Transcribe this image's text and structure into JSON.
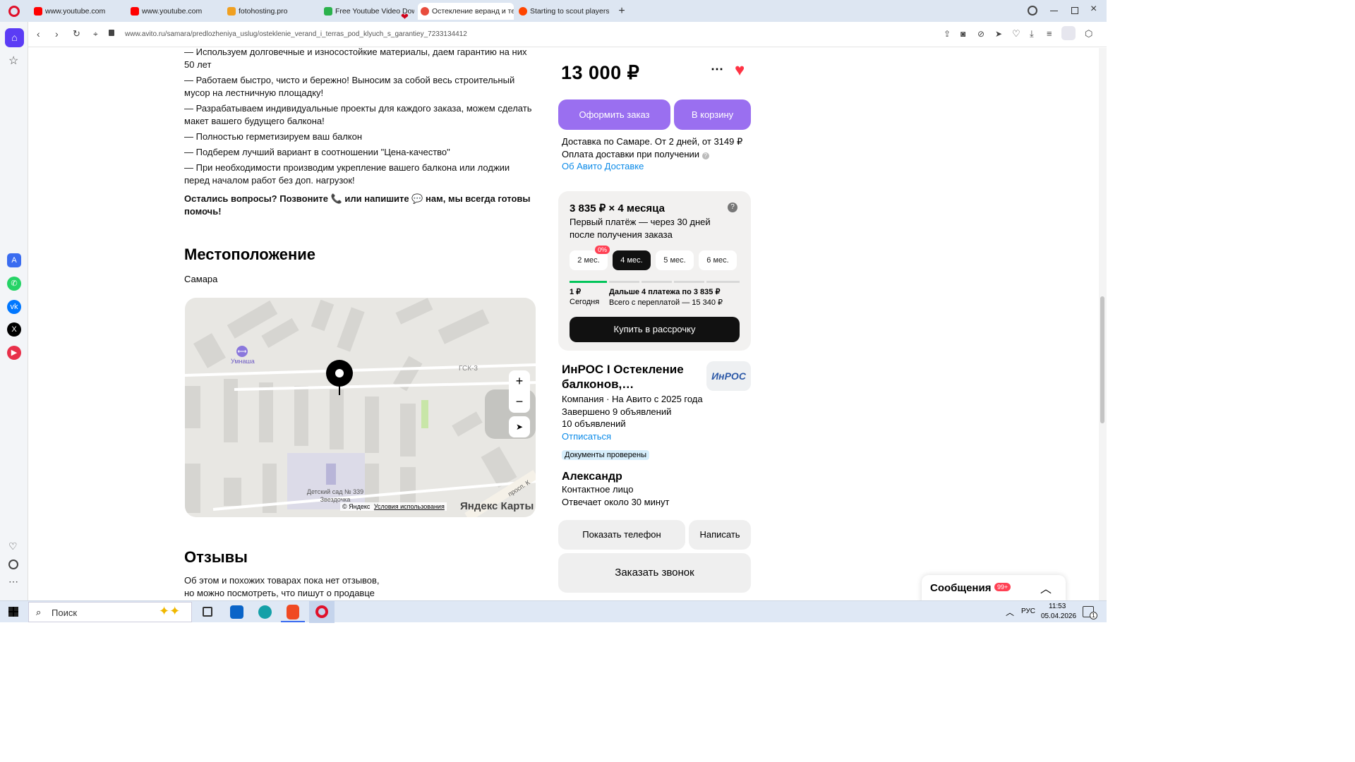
{
  "tabs": [
    {
      "label": "www.youtube.com",
      "color": "#ff0000"
    },
    {
      "label": "www.youtube.com",
      "color": "#ff0000"
    },
    {
      "label": "fotohosting.pro",
      "color": "#f0a020"
    },
    {
      "label": "Free Youtube Video Downl",
      "color": "#2bb24c"
    },
    {
      "label": "Остекление веранд и тер",
      "color": "#e84c3d"
    },
    {
      "label": "Starting to scout players fo",
      "color": "#ff4500"
    }
  ],
  "address": {
    "url": "www.avito.ru/samara/predlozheniya_uslug/osteklenie_verand_i_terras_pod_klyuch_s_garantiey_7233134412"
  },
  "description": {
    "lines": [
      "— Используем долговечные и износостойкие материалы, даем гарантию на них 50 лет",
      "— Работаем быстро, чисто и бережно! Выносим за собой весь строительный мусор на лестничную площадку!",
      "— Разрабатываем индивидуальные проекты для каждого заказа, можем сделать макет вашего будущего балкона!",
      "— Полностью герметизируем ваш балкон",
      "— Подберем лучший вариант в соотношении \"Цена-качество\"",
      "— При необходимости производим укрепление вашего балкона или лоджии перед началом работ без доп. нагрузок!"
    ],
    "cta": "Остались вопросы? Позвоните 📞 или напишите 💬 нам, мы всегда готовы помочь!"
  },
  "location": {
    "title": "Местоположение",
    "city": "Самара"
  },
  "map": {
    "place": "Умнаша",
    "kindergarten": "Детский сад № 339 Звездочка",
    "garage": "ГСК-3",
    "copyright": "© Яндекс",
    "terms": "Условия использования",
    "brand": "Яндекс Карты",
    "street": "просп. К"
  },
  "reviews": {
    "title": "Отзывы",
    "text": "Об этом и похожих товарах пока нет отзывов, но можно посмотреть, что пишут о продавце"
  },
  "offer": {
    "price": "13 000 ₽",
    "order_label": "Оформить заказ",
    "cart_label": "В корзину",
    "delivery": "Доставка по Самаре. От 2 дней, от 3149 ₽",
    "payment": "Оплата доставки при получении",
    "delivery_link": "Об Авито Доставке"
  },
  "installment": {
    "title": "3 835 ₽ × 4 месяца",
    "subtitle": "Первый платёж — через 30 дней после получения заказа",
    "options": [
      "2 мес.",
      "4 мес.",
      "5 мес.",
      "6 мес."
    ],
    "badge": "0%",
    "today_amount": "1 ₽",
    "today_label": "Сегодня",
    "next_payments": "Дальше 4 платежа по 3 835 ₽",
    "total": "Всего с переплатой — 15 340 ₽",
    "buy_label": "Купить в рассрочку",
    "progress": 0.25
  },
  "seller": {
    "name": "ИнРОС I Остекление балконов,…",
    "logo_text": "ИнРОС",
    "type": "Компания · На Авито с 2025 года",
    "completed": "Завершено 9 объявлений",
    "ads": "10 объявлений",
    "unsubscribe": "Отписаться",
    "verified": "Документы проверены",
    "contact_name": "Александр",
    "contact_role": "Контактное лицо",
    "response": "Отвечает около 30 минут",
    "phone_label": "Показать телефон",
    "write_label": "Написать",
    "call_label": "Заказать звонок"
  },
  "messages": {
    "label": "Сообщения",
    "count": "99+"
  },
  "taskbar": {
    "search": "Поиск",
    "lang": "РУС",
    "time": "11:53",
    "date": "05.04.2026",
    "notif": "1"
  }
}
